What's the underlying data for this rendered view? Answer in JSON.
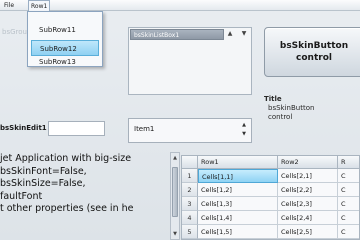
{
  "menubar": {
    "items": [
      "File",
      "Row1"
    ]
  },
  "dropdown": {
    "items": [
      "SubRow11",
      "SubRow12",
      "SubRow13"
    ],
    "selected_index": 1
  },
  "background_text": {
    "under_dropdown": "bsGroupBox"
  },
  "listbox": {
    "selected_item": "bsSkinListBox1"
  },
  "skin_button": {
    "line1": "bsSkinButton",
    "line2": "control"
  },
  "title_group": {
    "title": "Title",
    "line1": "bsSkinButton",
    "line2": "control"
  },
  "edit": {
    "label": "bsSkinEdit1",
    "value": ""
  },
  "combo": {
    "value": "Item1"
  },
  "textblock": {
    "lines": [
      "jet Application with big-size",
      "bsSkinFont=False,",
      "bsSkinSize=False,",
      "faultFont",
      "t other properties (see in he"
    ]
  },
  "grid": {
    "columns": [
      "Row1",
      "Row2",
      "R"
    ],
    "rows": [
      {
        "header": "1",
        "cells": [
          "Cells[1,1]",
          "Cells[2,1]",
          "C"
        ]
      },
      {
        "header": "2",
        "cells": [
          "Cells[1,2]",
          "Cells[2,2]",
          "C"
        ]
      },
      {
        "header": "3",
        "cells": [
          "Cells[1,3]",
          "Cells[2,3]",
          "C"
        ]
      },
      {
        "header": "4",
        "cells": [
          "Cells[1,4]",
          "Cells[2,4]",
          "C"
        ]
      },
      {
        "header": "5",
        "cells": [
          "Cells[1,5]",
          "Cells[2,5]",
          "C"
        ]
      }
    ],
    "selected_cell": "Cells[1,1]"
  },
  "colors": {
    "accent": "#8fd1f2",
    "background": "#dde3e8"
  }
}
